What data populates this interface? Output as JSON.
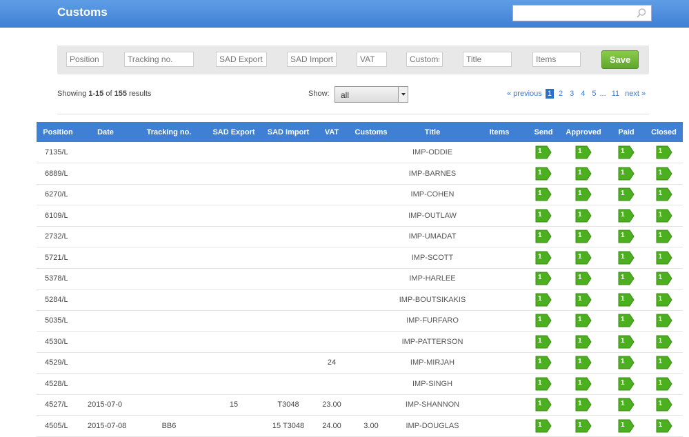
{
  "header": {
    "title": "Customs",
    "search_placeholder": ""
  },
  "filters": {
    "position": "Position",
    "tracking": "Tracking no.",
    "sad_export": "SAD Export",
    "sad_import": "SAD Import",
    "vat": "VAT",
    "customs": "Customs",
    "title": "Title",
    "items": "Items",
    "save_label": "Save"
  },
  "summary": {
    "prefix": "Showing",
    "range": "1-15",
    "of": "of",
    "total": "155",
    "suffix": "results"
  },
  "show": {
    "label": "Show:",
    "value": "all"
  },
  "pagination": {
    "previous": "« previous",
    "pages": [
      "1",
      "2",
      "3",
      "4",
      "5"
    ],
    "active": "1",
    "ellipsis": "...",
    "last": "11",
    "next": "next »"
  },
  "table": {
    "columns": [
      "Position",
      "Date",
      "Tracking no.",
      "SAD Export",
      "SAD Import",
      "VAT",
      "Customs",
      "Title",
      "Items",
      "Send",
      "Approved",
      "Paid",
      "Closed"
    ],
    "rows": [
      {
        "position": "7135/L",
        "date": "",
        "tracking": "",
        "sad_export": "",
        "sad_import": "",
        "vat": "",
        "customs": "",
        "title": "IMP-ODDIE",
        "items": "",
        "send": "1",
        "approved": "1",
        "paid": "1",
        "closed": "1"
      },
      {
        "position": "6889/L",
        "date": "",
        "tracking": "",
        "sad_export": "",
        "sad_import": "",
        "vat": "",
        "customs": "",
        "title": "IMP-BARNES",
        "items": "",
        "send": "1",
        "approved": "1",
        "paid": "1",
        "closed": "1"
      },
      {
        "position": "6270/L",
        "date": "",
        "tracking": "",
        "sad_export": "",
        "sad_import": "",
        "vat": "",
        "customs": "",
        "title": "IMP-COHEN",
        "items": "",
        "send": "1",
        "approved": "1",
        "paid": "1",
        "closed": "1"
      },
      {
        "position": "6109/L",
        "date": "",
        "tracking": "",
        "sad_export": "",
        "sad_import": "",
        "vat": "",
        "customs": "",
        "title": "IMP-OUTLAW",
        "items": "",
        "send": "1",
        "approved": "1",
        "paid": "1",
        "closed": "1"
      },
      {
        "position": "2732/L",
        "date": "",
        "tracking": "",
        "sad_export": "",
        "sad_import": "",
        "vat": "",
        "customs": "",
        "title": "IMP-UMADAT",
        "items": "",
        "send": "1",
        "approved": "1",
        "paid": "1",
        "closed": "1"
      },
      {
        "position": "5721/L",
        "date": "",
        "tracking": "",
        "sad_export": "",
        "sad_import": "",
        "vat": "",
        "customs": "",
        "title": "IMP-SCOTT",
        "items": "",
        "send": "1",
        "approved": "1",
        "paid": "1",
        "closed": "1"
      },
      {
        "position": "5378/L",
        "date": "",
        "tracking": "",
        "sad_export": "",
        "sad_import": "",
        "vat": "",
        "customs": "",
        "title": "IMP-HARLEE",
        "items": "",
        "send": "1",
        "approved": "1",
        "paid": "1",
        "closed": "1"
      },
      {
        "position": "5284/L",
        "date": "",
        "tracking": "",
        "sad_export": "",
        "sad_import": "",
        "vat": "",
        "customs": "",
        "title": "IMP-BOUTSIKAKIS",
        "items": "",
        "send": "1",
        "approved": "1",
        "paid": "1",
        "closed": "1"
      },
      {
        "position": "5035/L",
        "date": "",
        "tracking": "",
        "sad_export": "",
        "sad_import": "",
        "vat": "",
        "customs": "",
        "title": "IMP-FURFARO",
        "items": "",
        "send": "1",
        "approved": "1",
        "paid": "1",
        "closed": "1"
      },
      {
        "position": "4530/L",
        "date": "",
        "tracking": "",
        "sad_export": "",
        "sad_import": "",
        "vat": "",
        "customs": "",
        "title": "IMP-PATTERSON",
        "items": "",
        "send": "1",
        "approved": "1",
        "paid": "1",
        "closed": "1"
      },
      {
        "position": "4529/L",
        "date": "",
        "tracking": "",
        "sad_export": "",
        "sad_import": "",
        "vat": "24",
        "customs": "",
        "title": "IMP-MIRJAH",
        "items": "",
        "send": "1",
        "approved": "1",
        "paid": "1",
        "closed": "1"
      },
      {
        "position": "4528/L",
        "date": "",
        "tracking": "",
        "sad_export": "",
        "sad_import": "",
        "vat": "",
        "customs": "",
        "title": "IMP-SINGH",
        "items": "",
        "send": "1",
        "approved": "1",
        "paid": "1",
        "closed": "1"
      },
      {
        "position": "4527/L",
        "date": "2015-07-0",
        "tracking": "",
        "sad_export": "15",
        "sad_import": "T3048",
        "vat": "23.00",
        "customs": "",
        "title": "IMP-SHANNON",
        "items": "",
        "send": "1",
        "approved": "1",
        "paid": "1",
        "closed": "1"
      },
      {
        "position": "4505/L",
        "date": "2015-07-08",
        "tracking": "BB6",
        "sad_export": "",
        "sad_import": "15 T3048",
        "vat": "24.00",
        "customs": "3.00",
        "title": "IMP-DOUGLAS",
        "items": "",
        "send": "1",
        "approved": "1",
        "paid": "1",
        "closed": "1"
      }
    ]
  },
  "colors": {
    "header_blue": "#3f80d4",
    "save_green": "#5fa62c",
    "flag_green": "#4caf1f"
  }
}
